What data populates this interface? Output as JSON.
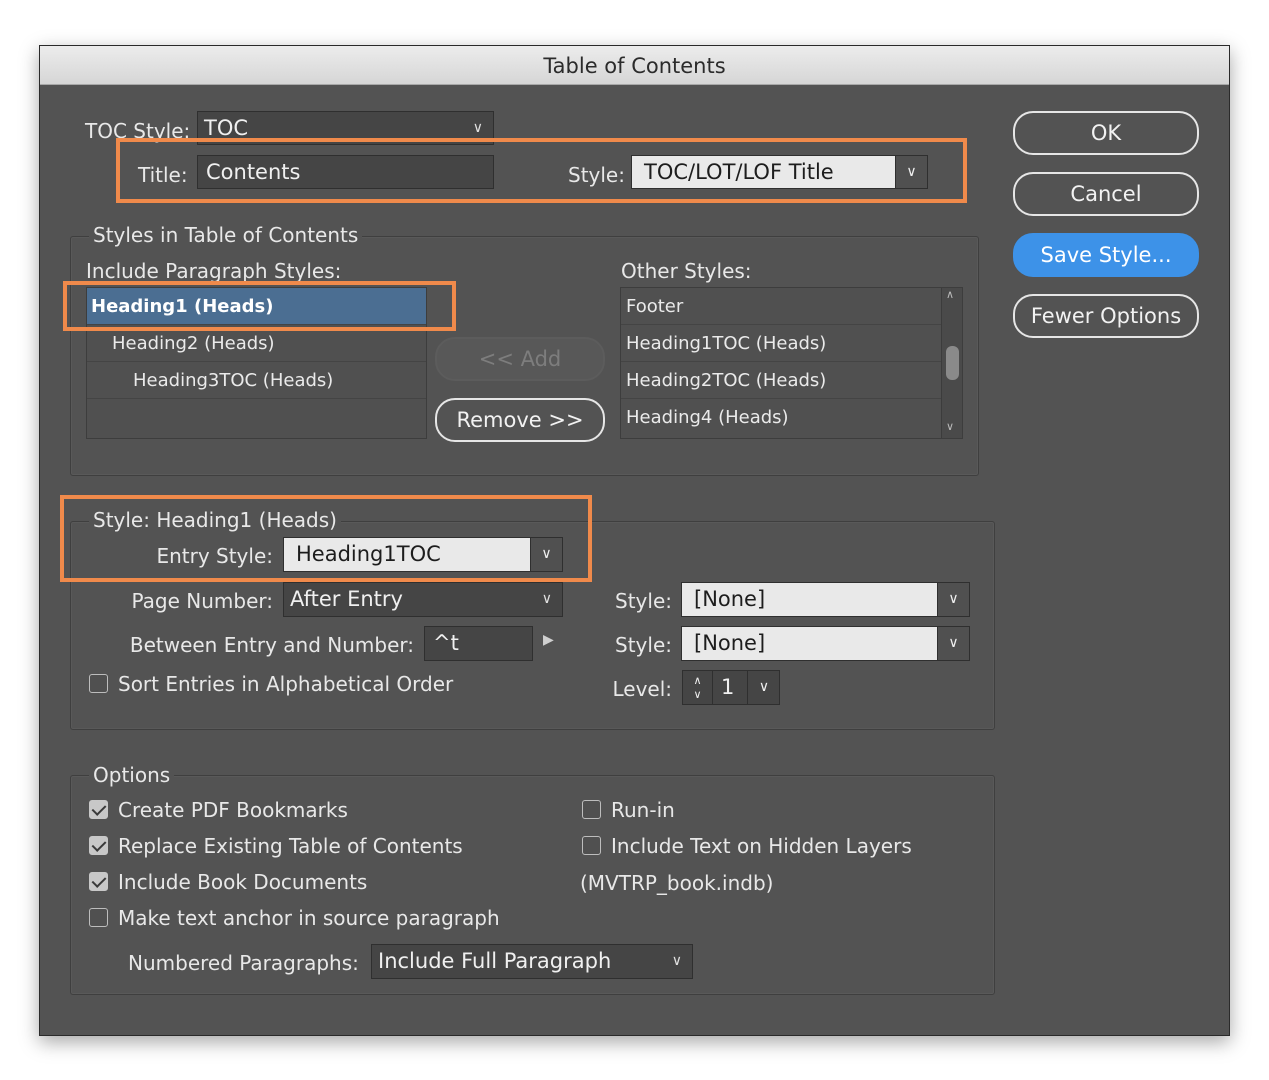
{
  "window": {
    "title": "Table of Contents"
  },
  "toc_style": {
    "label": "TOC Style:",
    "value": "TOC"
  },
  "title_field": {
    "label": "Title:",
    "value": "Contents"
  },
  "title_style": {
    "label": "Style:",
    "value": "TOC/LOT/LOF Title"
  },
  "styles_group": {
    "legend": "Styles in Table of Contents",
    "include_label": "Include Paragraph Styles:",
    "include_items": [
      "Heading1 (Heads)",
      "Heading2 (Heads)",
      "Heading3TOC (Heads)"
    ],
    "other_label": "Other Styles:",
    "other_items": [
      "Footer",
      "Heading1TOC (Heads)",
      "Heading2TOC (Heads)",
      "Heading4 (Heads)"
    ],
    "add_button": "<< Add",
    "remove_button": "Remove >>"
  },
  "style_group": {
    "legend": "Style: Heading1 (Heads)",
    "entry_style_label": "Entry Style:",
    "entry_style_value": "Heading1TOC",
    "page_number_label": "Page Number:",
    "page_number_value": "After Entry",
    "between_label": "Between Entry and Number:",
    "between_value": "^t",
    "style1_label": "Style:",
    "style1_value": "[None]",
    "style2_label": "Style:",
    "style2_value": "[None]",
    "sort_label": "Sort Entries in Alphabetical Order",
    "sort_checked": false,
    "level_label": "Level:",
    "level_value": "1"
  },
  "options_group": {
    "legend": "Options",
    "create_pdf": {
      "label": "Create PDF Bookmarks",
      "checked": true
    },
    "replace_existing": {
      "label": "Replace Existing Table of Contents",
      "checked": true
    },
    "include_book": {
      "label": "Include Book Documents",
      "checked": true
    },
    "make_anchor": {
      "label": "Make text anchor in source paragraph",
      "checked": false
    },
    "run_in": {
      "label": "Run-in",
      "checked": false
    },
    "include_hidden": {
      "label": "Include Text on Hidden Layers",
      "checked": false
    },
    "book_name": "(MVTRP_book.indb)",
    "numbered_label": "Numbered Paragraphs:",
    "numbered_value": "Include Full Paragraph"
  },
  "buttons": {
    "ok": "OK",
    "cancel": "Cancel",
    "save_style": "Save Style...",
    "fewer_options": "Fewer Options"
  },
  "colors": {
    "accent": "#3d92e8",
    "highlight": "#f08a4b",
    "selection": "#4b6e92",
    "panel": "#535353"
  },
  "icons": {
    "dropdown": "chevron-down-icon",
    "stepper": "stepper-icon",
    "triangle": "triangle-right-icon"
  }
}
